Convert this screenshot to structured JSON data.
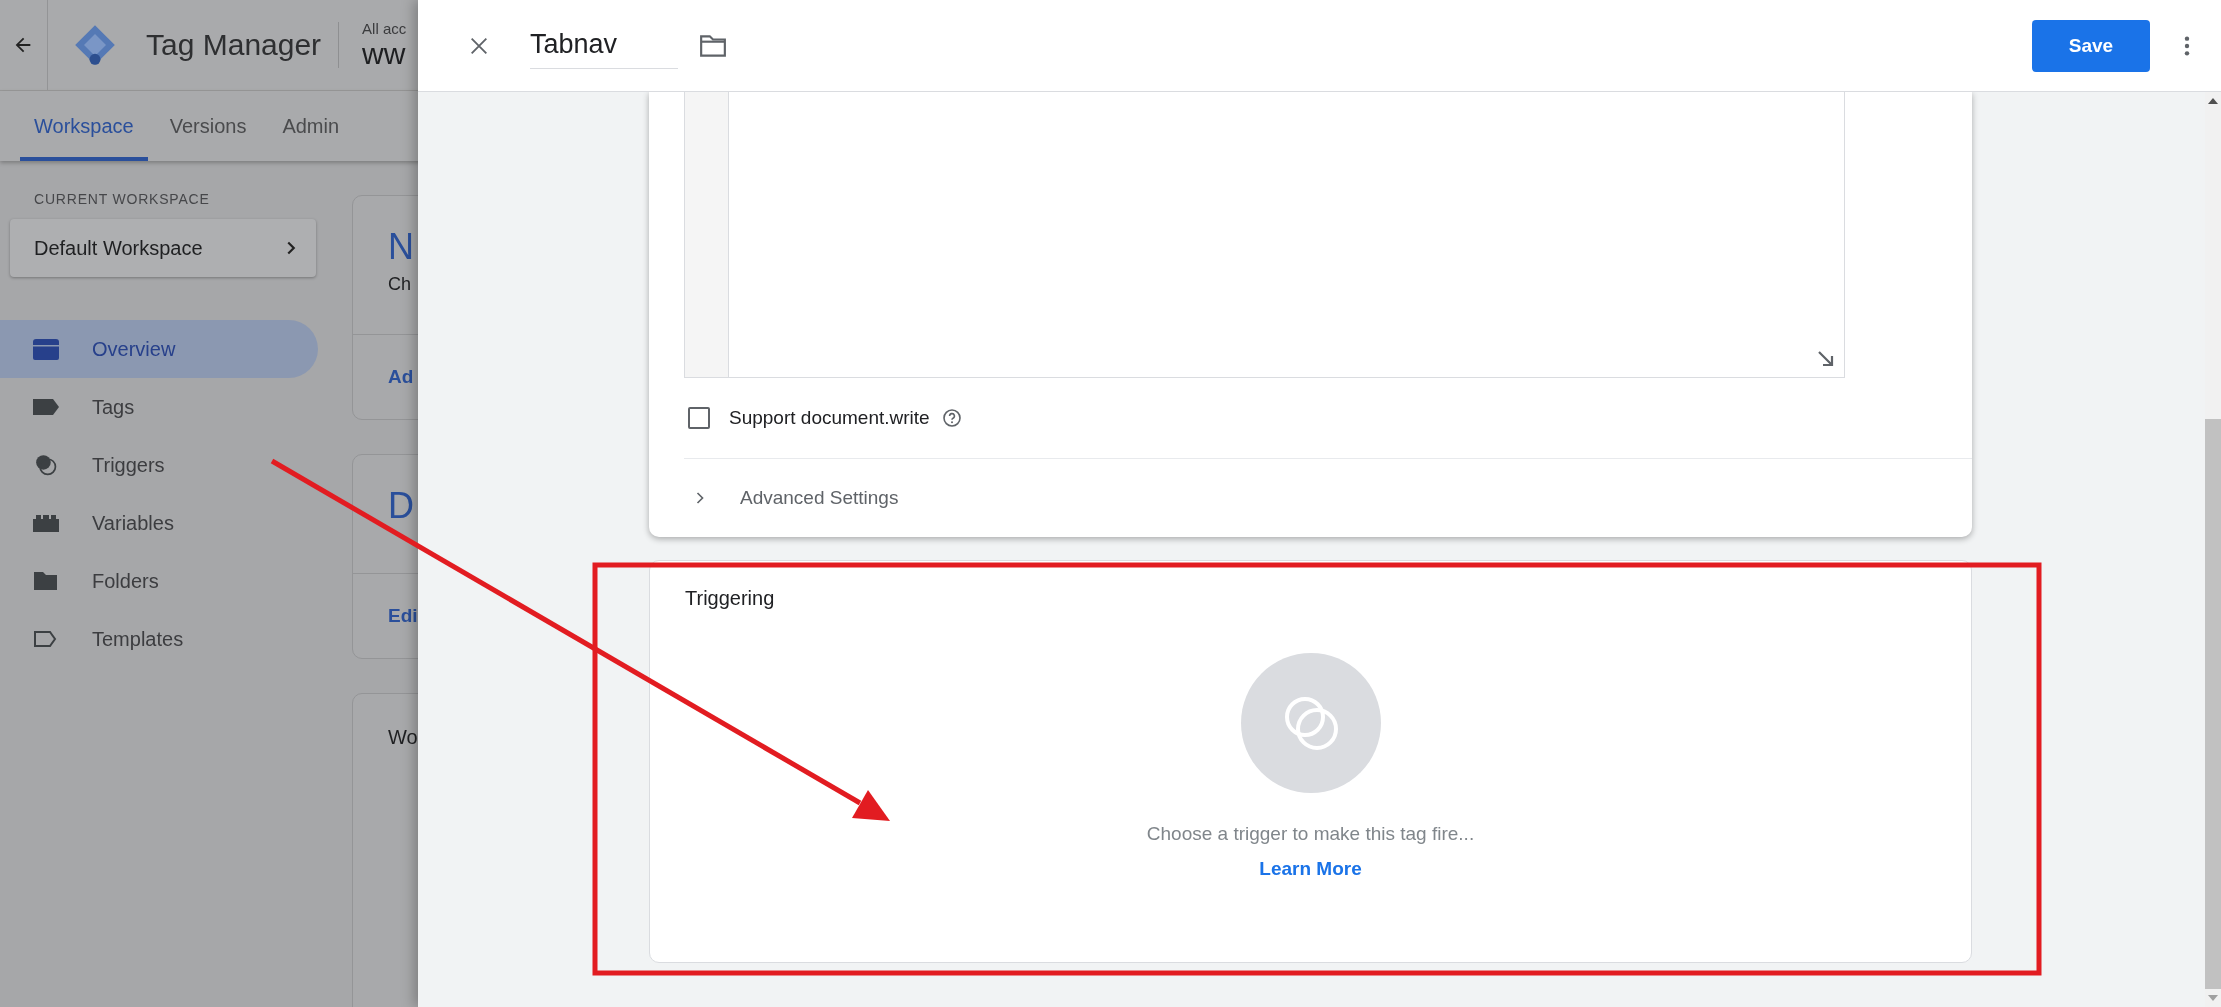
{
  "app_header": {
    "product": "Tag Manager",
    "account_label": "All acc",
    "container": "ww"
  },
  "nav_tabs": [
    {
      "label": "Workspace",
      "selected": true
    },
    {
      "label": "Versions",
      "selected": false
    },
    {
      "label": "Admin",
      "selected": false
    }
  ],
  "sidebar": {
    "section_label": "CURRENT WORKSPACE",
    "workspace": "Default Workspace",
    "items": [
      {
        "label": "Overview",
        "kind": "overview",
        "selected": true
      },
      {
        "label": "Tags",
        "kind": "tag",
        "selected": false
      },
      {
        "label": "Triggers",
        "kind": "trigger",
        "selected": false
      },
      {
        "label": "Variables",
        "kind": "variable",
        "selected": false
      },
      {
        "label": "Folders",
        "kind": "folder",
        "selected": false
      },
      {
        "label": "Templates",
        "kind": "template",
        "selected": false
      }
    ]
  },
  "cards": [
    {
      "title": "N",
      "text": "Ch",
      "action": "Ad"
    },
    {
      "title": "D",
      "action": "Edi"
    },
    {
      "title": "Wo"
    }
  ],
  "editor": {
    "name": "Tabnav",
    "save": "Save"
  },
  "tag_config": {
    "support_document_write": {
      "label": "Support document.write",
      "checked": false
    },
    "advanced": {
      "label": "Advanced Settings",
      "expanded": false
    }
  },
  "triggering": {
    "title": "Triggering",
    "hint": "Choose a trigger to make this tag fire...",
    "link": "Learn More"
  }
}
